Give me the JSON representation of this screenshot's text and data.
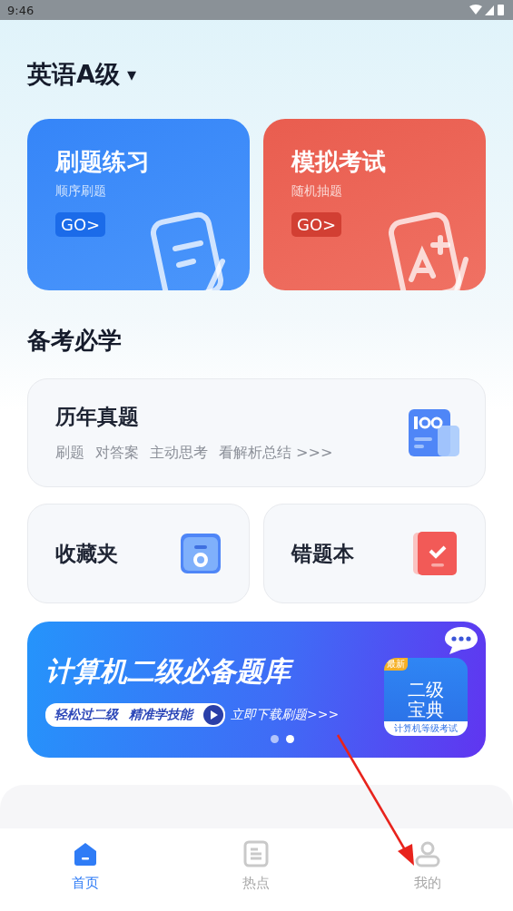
{
  "status_bar": {
    "time": "9:46"
  },
  "header": {
    "title": "英语A级",
    "dropdown": "▾"
  },
  "practice_cards": [
    {
      "kind": "blue",
      "title": "刷题练习",
      "subtitle": "顺序刷题",
      "go": "GO>"
    },
    {
      "kind": "red",
      "title": "模拟考试",
      "subtitle": "随机抽题",
      "go": "GO>"
    }
  ],
  "section": {
    "title": "备考必学"
  },
  "past_papers": {
    "title": "历年真题",
    "tags": [
      "刷题",
      "对答案",
      "主动思考",
      "看解析总结 >>>"
    ]
  },
  "tools": [
    {
      "kind": "folder",
      "title": "收藏夹"
    },
    {
      "kind": "notebook",
      "title": "错题本"
    }
  ],
  "banner": {
    "headline": "计算机二级必备题库",
    "pill": [
      "轻松过二级",
      "精准学技能"
    ],
    "cta": "立即下载刷题>>>",
    "app_icon": {
      "ribbon": "最新",
      "line1": "二级",
      "line2": "宝典",
      "caption": "计算机等级考试"
    },
    "dots": [
      {
        "selected": false
      },
      {
        "selected": true
      }
    ]
  },
  "tab_bar": [
    {
      "kind": "home",
      "label": "首页",
      "selected": true
    },
    {
      "kind": "news",
      "label": "热点",
      "selected": false
    },
    {
      "kind": "user",
      "label": "我的",
      "selected": false
    }
  ]
}
